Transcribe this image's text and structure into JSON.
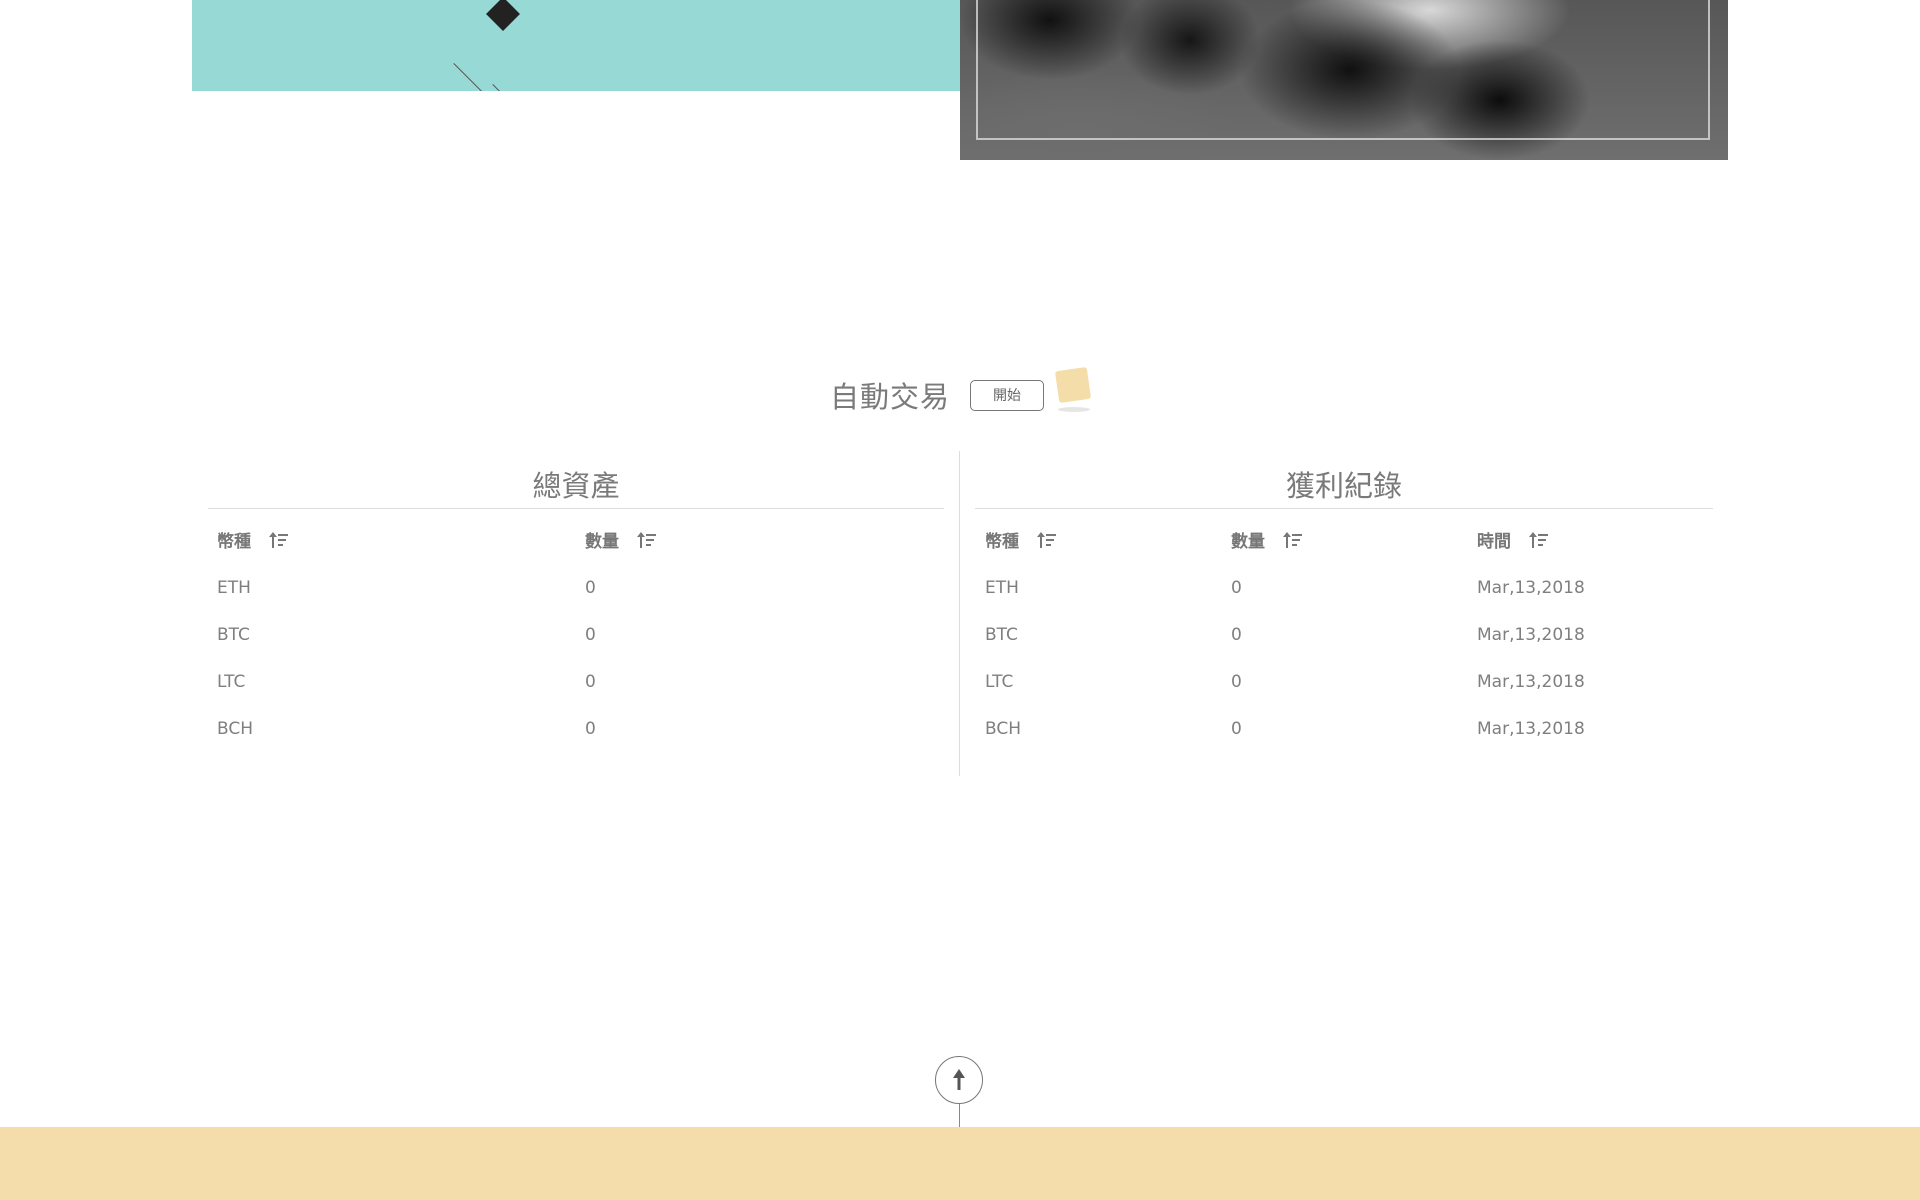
{
  "colors": {
    "hero_teal": "#97dad5",
    "footer_sand": "#f4ddaa",
    "status_cube": "#f4dda9",
    "text_gray": "#7a7a7a"
  },
  "hero": {
    "scroll_icon": "arrow-down-icon"
  },
  "auto_trade": {
    "title": "自動交易",
    "start_label": "開始",
    "status_icon": "status-cube-icon"
  },
  "assets": {
    "title": "總資產",
    "columns": [
      "幣種",
      "數量"
    ],
    "rows": [
      {
        "coin": "ETH",
        "amount": "0"
      },
      {
        "coin": "BTC",
        "amount": "0"
      },
      {
        "coin": "LTC",
        "amount": "0"
      },
      {
        "coin": "BCH",
        "amount": "0"
      }
    ]
  },
  "profits": {
    "title": "獲利紀錄",
    "columns": [
      "幣種",
      "數量",
      "時間"
    ],
    "rows": [
      {
        "coin": "ETH",
        "amount": "0",
        "time": "Mar,13,2018"
      },
      {
        "coin": "BTC",
        "amount": "0",
        "time": "Mar,13,2018"
      },
      {
        "coin": "LTC",
        "amount": "0",
        "time": "Mar,13,2018"
      },
      {
        "coin": "BCH",
        "amount": "0",
        "time": "Mar,13,2018"
      }
    ]
  },
  "back_to_top_icon": "arrow-up-icon"
}
